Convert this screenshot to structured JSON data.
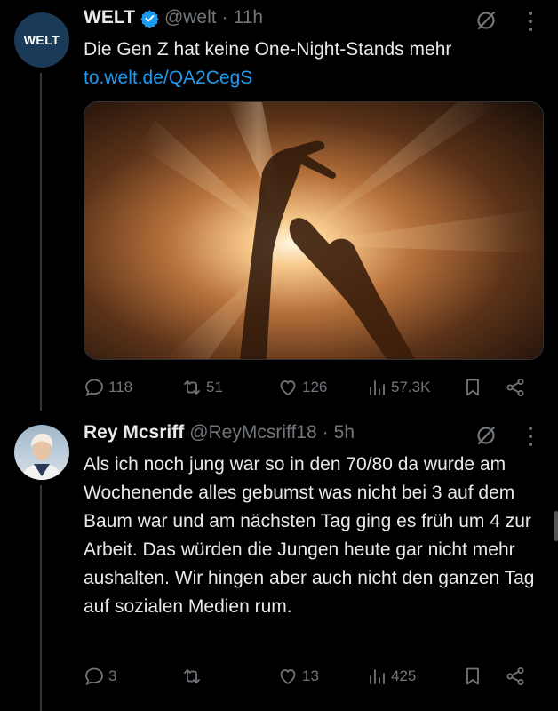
{
  "tweet1": {
    "avatar_text": "WELT",
    "name": "WELT",
    "handle": "@welt",
    "time": "11h",
    "text": "Die Gen Z hat keine One-Night-Stands mehr",
    "link": "to.welt.de/QA2CegS",
    "stats": {
      "replies": "118",
      "retweets": "51",
      "likes": "126",
      "views": "57.3K"
    }
  },
  "tweet2": {
    "name": "Rey Mcsriff",
    "handle": "@ReyMcsriff18",
    "time": "5h",
    "text": "Als ich noch jung war so in den 70/80 da wurde am Wochenende alles gebumst was nicht bei 3 auf dem Baum war und am nächsten Tag ging es früh um 4 zur Arbeit. Das würden die Jungen heute gar nicht mehr aushalten. Wir hingen aber auch nicht den ganzen Tag auf sozialen Medien rum.",
    "stats": {
      "replies": "3",
      "retweets": "",
      "likes": "13",
      "views": "425"
    }
  },
  "separator": "·",
  "colors": {
    "background": "#000000",
    "link": "#1d9bf0",
    "muted": "#71767b",
    "verified": "#1d9bf0"
  }
}
